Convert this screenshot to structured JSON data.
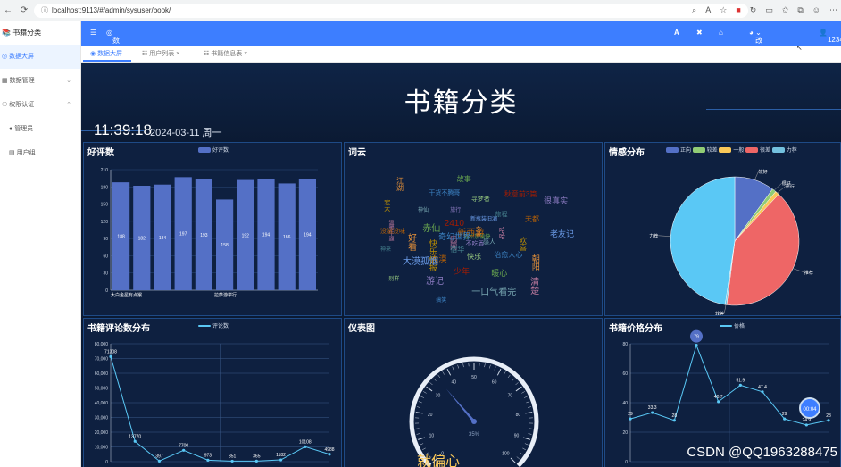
{
  "browser": {
    "url": "localhost:9113/#/admin/sysuser/book/"
  },
  "sidebar": {
    "title": "书籍分类",
    "items": [
      {
        "label": "数据大屏"
      },
      {
        "label": "数据管理"
      },
      {
        "label": "权限认证"
      },
      {
        "label": "管理员"
      },
      {
        "label": "用户组"
      }
    ]
  },
  "topnav": {
    "title": "数据大屏",
    "font_label": "A",
    "theme_label": "改变主题",
    "user_label": "1234"
  },
  "tabs": [
    {
      "label": "数据大屏"
    },
    {
      "label": "用户列表"
    },
    {
      "label": "书籍信息表"
    }
  ],
  "screen": {
    "title": "书籍分类",
    "time": "11:39:18",
    "date": "2024-03-11  周一"
  },
  "colors": {
    "accent": "#3d7eff",
    "bar": "#5470c6",
    "bg": "#0b1a33",
    "line": "#5ac8f5"
  },
  "chart_data": [
    {
      "type": "bar",
      "title": "好评数",
      "legend": [
        "好评数"
      ],
      "categories": [
        "大白金星有点猴",
        "",
        "",
        "",
        "",
        "拉萨游学行",
        "",
        "",
        "",
        ""
      ],
      "values": [
        188,
        182,
        184,
        197,
        193,
        158,
        192,
        194,
        186,
        194
      ],
      "ylim": [
        0,
        210
      ],
      "yticks": [
        0,
        30,
        60,
        90,
        120,
        150,
        180,
        210
      ]
    },
    {
      "type": "wordcloud",
      "title": "词云",
      "words": [
        "轻松加愉快",
        "园网",
        "新西游",
        "不吃香",
        "奇幻世界",
        "女帝",
        "宿华",
        "2410",
        "感人",
        "快乐情报",
        "新瓶装旧酒",
        "快乐",
        "赤仙",
        "哈哈",
        "大漠",
        "旅行",
        "治愈人心",
        "好看",
        "旅程",
        "少年",
        "神仙",
        "欢喜",
        "大漠孤烟",
        "寻梦者",
        "暖心",
        "温暖牛逼",
        "天都",
        "游记",
        "干货不腾哥",
        "朝阳",
        "神来",
        "秋意前3篇",
        "一口气看完",
        "宏大",
        "老友记",
        "别样",
        "故事",
        "清楚",
        "没滋没味",
        "很真实",
        "搞笑",
        "江湖"
      ]
    },
    {
      "type": "pie",
      "title": "情感分布",
      "legend": [
        "正向",
        "较差",
        "一般",
        "很差",
        "力荐"
      ],
      "slices": [
        {
          "name": "一般",
          "label": "较好",
          "value": 10
        },
        {
          "name": "较差",
          "label": "很好",
          "value": 1
        },
        {
          "name": "正向",
          "label": "还行",
          "value": 1
        },
        {
          "name": "力荐",
          "label": "推荐",
          "value": 40
        },
        {
          "name": "很差",
          "label": "较差",
          "value": 0.4
        },
        {
          "name": "一般2",
          "label": "力荐",
          "value": 47.6
        }
      ]
    },
    {
      "type": "line",
      "title": "书籍评论数分布",
      "legend": [
        "评论数"
      ],
      "values": [
        71308,
        13770,
        397,
        7700,
        973,
        351,
        365,
        1182,
        10108,
        4988
      ],
      "labels": [
        "71308",
        "13770",
        "397",
        "7700",
        "973",
        "351",
        "365",
        "1182",
        "10108",
        "4988"
      ],
      "ylim": [
        0,
        80000
      ],
      "yticks": [
        0,
        10000,
        20000,
        30000,
        40000,
        50000,
        60000,
        70000,
        80000
      ],
      "ytick_labels": [
        "0",
        "10,000",
        "20,000",
        "30,000",
        "40,000",
        "50,000",
        "60,000",
        "70,000",
        "80,000"
      ]
    },
    {
      "type": "gauge",
      "title": "仪表图",
      "value": 35,
      "value_label": "35%",
      "caption": "就偏心",
      "ticks": [
        "0",
        "10",
        "20",
        "30",
        "40",
        "50",
        "60",
        "70",
        "80",
        "90",
        "100"
      ]
    },
    {
      "type": "line",
      "title": "书籍价格分布",
      "legend": [
        "价格"
      ],
      "values": [
        29,
        33.3,
        28,
        79,
        40.7,
        51.9,
        47.4,
        29,
        24.9,
        28
      ],
      "labels": [
        "29",
        "33.3",
        "28",
        "79",
        "40.7",
        "51.9",
        "47.4",
        "29",
        "24.9",
        "28"
      ],
      "ylim": [
        0,
        80
      ],
      "yticks": [
        0,
        20,
        40,
        60,
        80
      ]
    }
  ],
  "watermark": "CSDN @QQ1963288475",
  "float_button": "00:04"
}
